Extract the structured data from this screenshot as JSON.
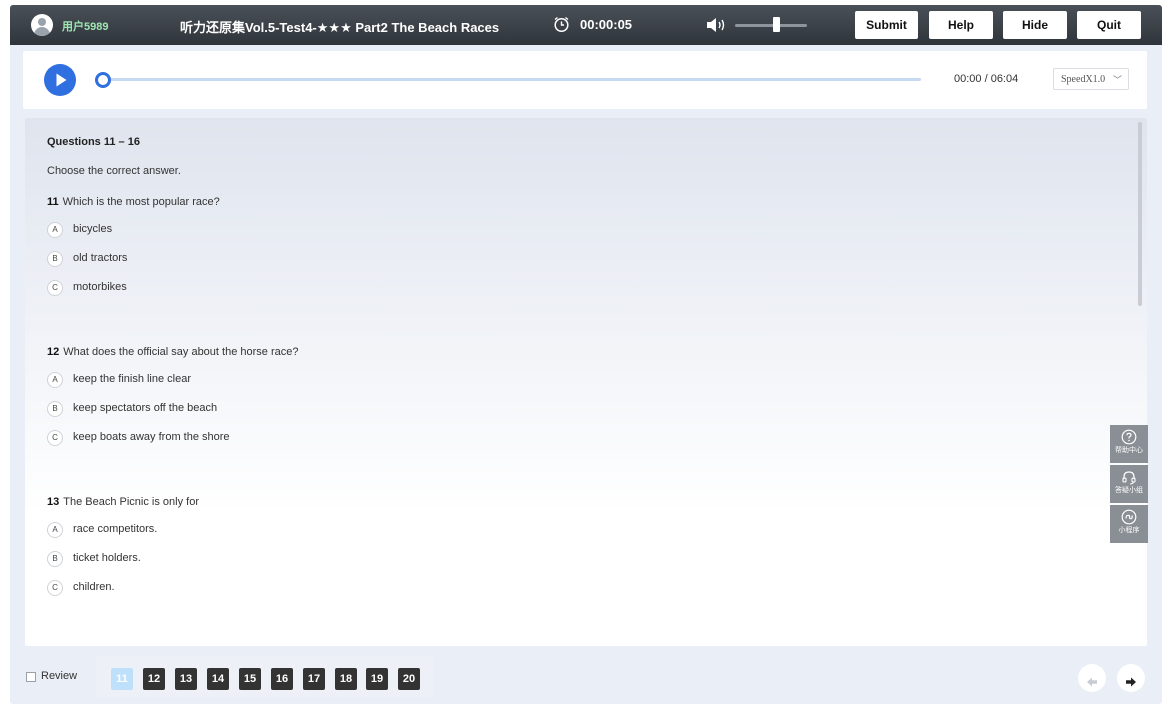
{
  "header": {
    "username": "用户5989",
    "title": "听力还原集Vol.5-Test4-★★★ Part2 The Beach Races",
    "timer": "00:00:05",
    "buttons": [
      "Submit",
      "Help",
      "Hide",
      "Quit"
    ],
    "volume_level": 0.57
  },
  "audio": {
    "time": "00:00 / 06:04",
    "speed": "SpeedX1.0",
    "progress": 0
  },
  "questions": {
    "heading": "Questions 11 – 16",
    "instruction": "Choose the correct answer.",
    "items": [
      {
        "number": "11",
        "text": "Which is the most popular race?",
        "options": [
          {
            "letter": "A",
            "text": "bicycles"
          },
          {
            "letter": "B",
            "text": "old tractors"
          },
          {
            "letter": "C",
            "text": "motorbikes"
          }
        ]
      },
      {
        "number": "12",
        "text": "What does the official say about the horse race?",
        "options": [
          {
            "letter": "A",
            "text": "keep the finish line clear"
          },
          {
            "letter": "B",
            "text": "keep spectators off the beach"
          },
          {
            "letter": "C",
            "text": "keep boats away from the shore"
          }
        ]
      },
      {
        "number": "13",
        "text": "The Beach Picnic is only for",
        "options": [
          {
            "letter": "A",
            "text": "race competitors."
          },
          {
            "letter": "B",
            "text": "ticket holders."
          },
          {
            "letter": "C",
            "text": "children."
          }
        ]
      }
    ]
  },
  "sidetools": [
    {
      "label": "帮助中心",
      "icon": "help-circle-icon"
    },
    {
      "label": "答疑小组",
      "icon": "headset-icon"
    },
    {
      "label": "小程序",
      "icon": "mini-program-icon"
    }
  ],
  "footer": {
    "review_label": "Review",
    "question_numbers": [
      "11",
      "12",
      "13",
      "14",
      "15",
      "16",
      "17",
      "18",
      "19",
      "20"
    ],
    "active_question": "11"
  },
  "colors": {
    "accent": "#2f6fe0",
    "header": "#3a4046",
    "active_question": "#bfe0fb"
  }
}
